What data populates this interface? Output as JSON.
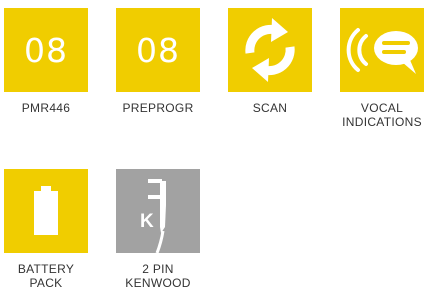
{
  "colors": {
    "accent_yellow": "#f0cd00",
    "accent_grey": "#a2a2a2",
    "icon_white": "#ffffff",
    "label_text": "#333333"
  },
  "tiles": [
    {
      "icon": "number-badge",
      "value": "08",
      "label": "PMR446"
    },
    {
      "icon": "number-badge",
      "value": "08",
      "label": "PREPROGR"
    },
    {
      "icon": "scan-arrows-icon",
      "label": "SCAN"
    },
    {
      "icon": "speech-bubble-sound-icon",
      "label_line1": "VOCAL",
      "label_line2": "INDICATIONS"
    },
    {
      "icon": "battery-icon",
      "label": "BATTERY PACK"
    },
    {
      "icon": "plug-connector-icon",
      "letter": "K",
      "label_line1": "2 PIN",
      "label_line2": "KENWOOD"
    }
  ]
}
